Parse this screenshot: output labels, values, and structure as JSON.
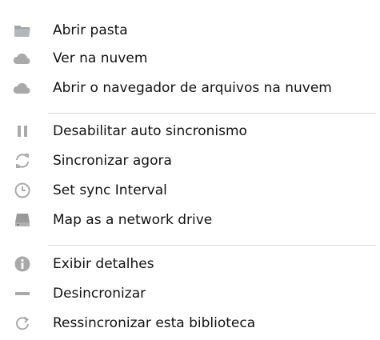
{
  "colors": {
    "icon": "#a9a9a9",
    "icon_dark": "#9a9a9a",
    "separator": "#d9d9d9",
    "text": "#121212"
  },
  "menu": {
    "items": [
      {
        "label": "Abrir pasta",
        "icon": "folder-icon"
      },
      {
        "label": "Ver na nuvem",
        "icon": "cloud-icon"
      },
      {
        "label": "Abrir o navegador de arquivos na nuvem",
        "icon": "cloud-icon"
      },
      {
        "label": "Desabilitar auto sincronismo",
        "icon": "pause-icon"
      },
      {
        "label": "Sincronizar agora",
        "icon": "sync-icon"
      },
      {
        "label": "Set sync Interval",
        "icon": "clock-icon"
      },
      {
        "label": "Map as a network drive",
        "icon": "network-drive-icon"
      },
      {
        "label": "Exibir detalhes",
        "icon": "info-icon"
      },
      {
        "label": "Desincronizar",
        "icon": "minus-icon"
      },
      {
        "label": "Ressincronizar esta biblioteca",
        "icon": "resync-icon"
      }
    ]
  }
}
